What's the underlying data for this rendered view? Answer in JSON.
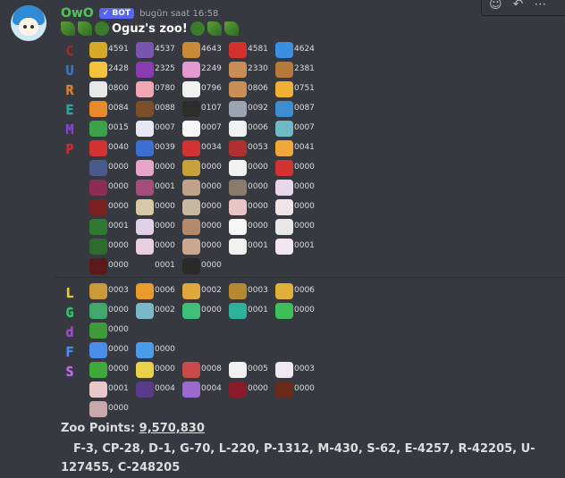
{
  "message": {
    "username": "OwO",
    "bot_badge": "✓ BOT",
    "timestamp": "bugün saat 16:58",
    "title": "Oguz's zoo!",
    "title_icons": [
      "herb-icon",
      "seedling-icon",
      "bush-icon"
    ],
    "toolbar_icons": [
      "reaction-icon",
      "reply-icon",
      "more-icon"
    ]
  },
  "rarity_letters": [
    {
      "char": "C",
      "color": "#9b2d2d"
    },
    {
      "char": "U",
      "color": "#3b77c9"
    },
    {
      "char": "R",
      "color": "#d9822b"
    },
    {
      "char": "E",
      "color": "#29a9a0"
    },
    {
      "char": "M",
      "color": "#8a3fd1"
    },
    {
      "char": "P",
      "color": "#d42a2a"
    },
    {
      "char": "L",
      "color": "#e8d12a"
    },
    {
      "char": "G",
      "color": "#34c46d"
    },
    {
      "char": "d",
      "color": "#9f4ad1"
    },
    {
      "char": "F",
      "color": "#4a8df0"
    },
    {
      "char": "S",
      "color": "#c46cf0"
    }
  ],
  "rows": [
    {
      "cells": [
        {
          "icon": "bee-icon",
          "value": "4591",
          "color": "#d6a92b"
        },
        {
          "icon": "caterpillar-icon",
          "value": "4537",
          "color": "#7a55b0"
        },
        {
          "icon": "snail-icon",
          "value": "4643",
          "color": "#c98b3a"
        },
        {
          "icon": "ladybug-icon",
          "value": "4581",
          "color": "#d2322d"
        },
        {
          "icon": "butterfly-icon",
          "value": "4624",
          "color": "#3a8fe0"
        }
      ]
    },
    {
      "cells": [
        {
          "icon": "chick-icon",
          "value": "2428",
          "color": "#f2c43a"
        },
        {
          "icon": "bug-icon",
          "value": "2325",
          "color": "#8a3bb0"
        },
        {
          "icon": "snail-icon",
          "value": "2249",
          "color": "#e39ad0"
        },
        {
          "icon": "dog-icon",
          "value": "2330",
          "color": "#c98e55"
        },
        {
          "icon": "squirrel-icon",
          "value": "2381",
          "color": "#b57a3a"
        }
      ]
    },
    {
      "cells": [
        {
          "icon": "sheep-icon",
          "value": "0800",
          "color": "#e8e8e8"
        },
        {
          "icon": "pig-icon",
          "value": "0780",
          "color": "#f2a6b3"
        },
        {
          "icon": "cow-icon",
          "value": "0796",
          "color": "#f0f0f0"
        },
        {
          "icon": "dog-icon",
          "value": "0806",
          "color": "#c98e55"
        },
        {
          "icon": "cat-icon",
          "value": "0751",
          "color": "#f0b033"
        }
      ]
    },
    {
      "cells": [
        {
          "icon": "tiger-icon",
          "value": "0084",
          "color": "#e88a2a"
        },
        {
          "icon": "eagle-icon",
          "value": "0088",
          "color": "#7a4f2a"
        },
        {
          "icon": "penguin-icon",
          "value": "0107",
          "color": "#2d2d2d"
        },
        {
          "icon": "elephant-icon",
          "value": "0092",
          "color": "#9aa5b1"
        },
        {
          "icon": "whale-icon",
          "value": "0087",
          "color": "#3d8ed0"
        }
      ]
    },
    {
      "cells": [
        {
          "icon": "dragon-icon",
          "value": "0015",
          "color": "#3ba24a"
        },
        {
          "icon": "unicorn-icon",
          "value": "0007",
          "color": "#e8e8f5"
        },
        {
          "icon": "snowman-icon",
          "value": "0007",
          "color": "#f5f5f5"
        },
        {
          "icon": "ghost-icon",
          "value": "0006",
          "color": "#eef0f2"
        },
        {
          "icon": "owl-icon",
          "value": "0007",
          "color": "#6fb9c4"
        }
      ]
    },
    {
      "cells": [
        {
          "icon": "bird-icon",
          "value": "0040",
          "color": "#d23232"
        },
        {
          "icon": "horse-icon",
          "value": "0039",
          "color": "#3b6fd1"
        },
        {
          "icon": "devil-icon",
          "value": "0034",
          "color": "#d23232"
        },
        {
          "icon": "imp-icon",
          "value": "0053",
          "color": "#b03030"
        },
        {
          "icon": "tiger-face-icon",
          "value": "0041",
          "color": "#f0a83a"
        }
      ]
    },
    {
      "cells": [
        {
          "icon": "cat-icon",
          "value": "0000",
          "color": "#4a5a8c"
        },
        {
          "icon": "girl-icon",
          "value": "0000",
          "color": "#e7a6c9"
        },
        {
          "icon": "goblin-icon",
          "value": "0000",
          "color": "#c9a03a"
        },
        {
          "icon": "blob-icon",
          "value": "0000",
          "color": "#f2f2f2"
        },
        {
          "icon": "reindeer-icon",
          "value": "0000",
          "color": "#d23232"
        }
      ]
    },
    {
      "cells": [
        {
          "icon": "shadow-icon",
          "value": "0000",
          "color": "#8b2e52"
        },
        {
          "icon": "girl-icon",
          "value": "0001",
          "color": "#a34d7a"
        },
        {
          "icon": "warrior-icon",
          "value": "0000",
          "color": "#c0a28c"
        },
        {
          "icon": "mage-icon",
          "value": "0000",
          "color": "#8c7a6a"
        },
        {
          "icon": "fairy-icon",
          "value": "0000",
          "color": "#e6d8e8"
        }
      ]
    },
    {
      "cells": [
        {
          "icon": "demon-icon",
          "value": "0000",
          "color": "#7a2020"
        },
        {
          "icon": "girl-icon",
          "value": "0000",
          "color": "#d9c8a8"
        },
        {
          "icon": "elf-icon",
          "value": "0000",
          "color": "#c8b8a0"
        },
        {
          "icon": "maid-icon",
          "value": "0000",
          "color": "#e8c4c4"
        },
        {
          "icon": "lady-icon",
          "value": "0000",
          "color": "#f0e4e8"
        }
      ]
    },
    {
      "cells": [
        {
          "icon": "snake-icon",
          "value": "0001",
          "color": "#2f7a33"
        },
        {
          "icon": "fox-icon",
          "value": "0000",
          "color": "#e0d0e8"
        },
        {
          "icon": "pet-icon",
          "value": "0000",
          "color": "#b58a6a"
        },
        {
          "icon": "panda-icon",
          "value": "0000",
          "color": "#f5f5f5"
        },
        {
          "icon": "blob-icon",
          "value": "0000",
          "color": "#e8e8e8"
        }
      ]
    },
    {
      "cells": [
        {
          "icon": "frog-icon",
          "value": "0000",
          "color": "#2f6a2f"
        },
        {
          "icon": "angel-icon",
          "value": "0000",
          "color": "#e8d0e0"
        },
        {
          "icon": "girl-icon",
          "value": "0000",
          "color": "#c8a890"
        },
        {
          "icon": "skull-icon",
          "value": "0001",
          "color": "#f0f0f0"
        },
        {
          "icon": "bunny-icon",
          "value": "0001",
          "color": "#f2e4f0"
        }
      ]
    },
    {
      "cells": [
        {
          "icon": "darkness-icon",
          "value": "0000",
          "color": "#5a1a1a"
        },
        {
          "icon": "",
          "value": "0001",
          "color": ""
        },
        {
          "icon": "reaper-icon",
          "value": "0000",
          "color": "#2a2a2a"
        }
      ]
    }
  ],
  "rows2": [
    {
      "cells": [
        {
          "icon": "deer-icon",
          "value": "0003",
          "color": "#c99a3a"
        },
        {
          "icon": "fox-icon",
          "value": "0006",
          "color": "#e89a2a"
        },
        {
          "icon": "lion-icon",
          "value": "0002",
          "color": "#e0a83a"
        },
        {
          "icon": "owl-icon",
          "value": "0003",
          "color": "#b5892f"
        },
        {
          "icon": "octopus-icon",
          "value": "0006",
          "color": "#e0b03a"
        }
      ]
    },
    {
      "cells": [
        {
          "icon": "dino-icon",
          "value": "0000",
          "color": "#3fa86a"
        },
        {
          "icon": "mouse-icon",
          "value": "0002",
          "color": "#7ab8c8"
        },
        {
          "icon": "gorilla-icon",
          "value": "0000",
          "color": "#3fbf7a"
        },
        {
          "icon": "lizard-icon",
          "value": "0001",
          "color": "#2fb09a"
        },
        {
          "icon": "spider-icon",
          "value": "0000",
          "color": "#3fbf5a"
        }
      ]
    },
    {
      "cells": [
        {
          "icon": "parrot-icon",
          "value": "0000",
          "color": "#3f9a3a"
        }
      ]
    },
    {
      "cells": [
        {
          "icon": "whale-icon",
          "value": "0000",
          "color": "#4a8de8"
        },
        {
          "icon": "cloud-icon",
          "value": "0000",
          "color": "#4a9de8"
        }
      ]
    },
    {
      "cells": [
        {
          "icon": "worm-icon",
          "value": "0000",
          "color": "#3fa83a"
        },
        {
          "icon": "star-icon",
          "value": "0000",
          "color": "#e8d04a"
        },
        {
          "icon": "girl-icon",
          "value": "0008",
          "color": "#c84a4a"
        },
        {
          "icon": "panda-icon",
          "value": "0005",
          "color": "#f0f0f0"
        },
        {
          "icon": "ghost-icon",
          "value": "0003",
          "color": "#f0e8f0"
        }
      ]
    },
    {
      "cells": [
        {
          "icon": "girl-icon",
          "value": "0001",
          "color": "#e8c8c8"
        },
        {
          "icon": "swirl-icon",
          "value": "0004",
          "color": "#5a3a8a"
        },
        {
          "icon": "flag-icon",
          "value": "0004",
          "color": "#9a6ad0"
        },
        {
          "icon": "rose-icon",
          "value": "0000",
          "color": "#8a1a2a"
        },
        {
          "icon": "woman-icon",
          "value": "0000",
          "color": "#6a2a1a"
        }
      ]
    },
    {
      "cells": [
        {
          "icon": "maid-icon",
          "value": "0000",
          "color": "#c8a8a8"
        }
      ]
    }
  ],
  "zoo_points_label": "Zoo Points: ",
  "zoo_points_value": "9,570,830",
  "breakdown": "F-3, CP-28, D-1, G-70, L-220, P-1312, M-430, S-62, E-4257, R-42205, U-127455, C-248205"
}
